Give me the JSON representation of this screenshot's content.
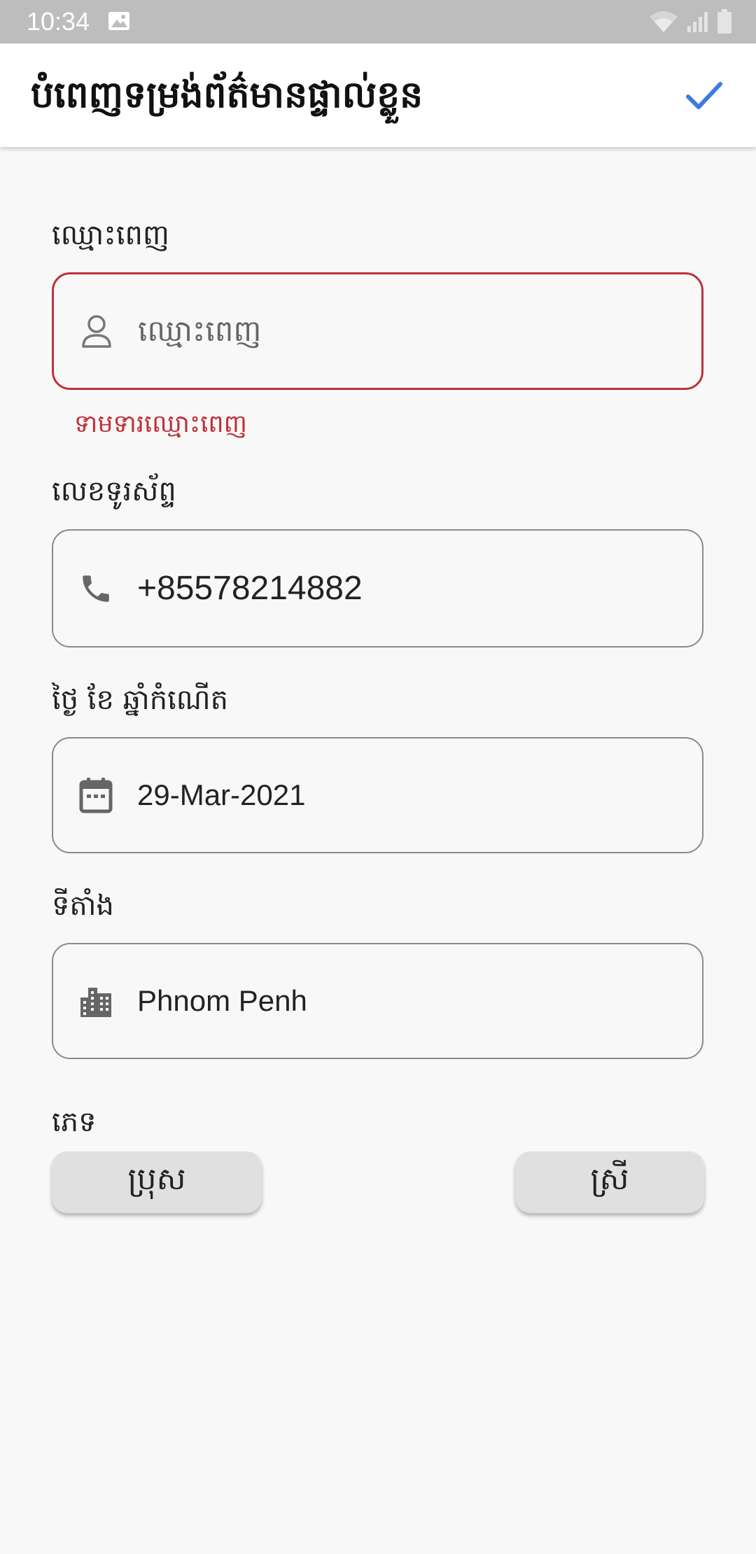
{
  "status_bar": {
    "time": "10:34"
  },
  "header": {
    "title": "បំពេញទម្រង់ព័ត៌មានផ្ទាល់ខ្លួន",
    "submit_icon": "check-icon"
  },
  "form": {
    "name": {
      "label": "ឈ្មោះពេញ",
      "placeholder": "ឈ្មោះពេញ",
      "value": "",
      "icon": "person-icon",
      "error": "ទាមទារឈ្មោះពេញ"
    },
    "phone": {
      "label": "លេខទូរស័ព្ទ",
      "value": "+85578214882",
      "icon": "phone-icon"
    },
    "birthdate": {
      "label": "ថ្ងៃ ខែ ឆ្នាំកំណើត",
      "value": "29-Mar-2021",
      "icon": "calendar-icon"
    },
    "location": {
      "label": "ទីតាំង",
      "value": "Phnom Penh",
      "icon": "city-icon"
    },
    "gender": {
      "label": "ភេទ",
      "male_label": "ប្រុស",
      "female_label": "ស្រី"
    }
  },
  "colors": {
    "accent": "#3b7be3",
    "error": "#c0303a",
    "border": "#8a8a8a",
    "status_bar": "#bdbdbd"
  }
}
